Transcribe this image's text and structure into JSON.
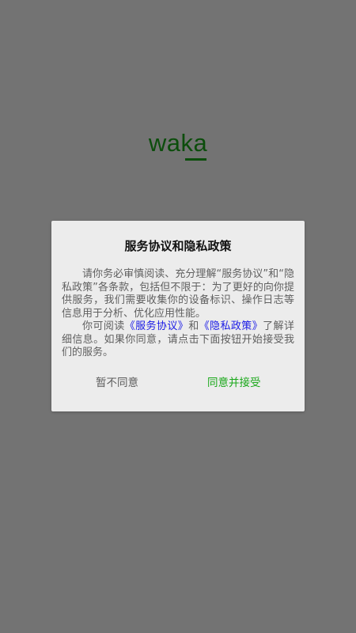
{
  "app": {
    "logo_text": "waka",
    "logo_color": "#0c4d0c",
    "background_color": "#737373"
  },
  "dialog": {
    "title": "服务协议和隐私政策",
    "paragraph1": "请你务必审慎阅读、充分理解“服务协议”和“隐私政策”各条款，包括但不限于：为了更好的向你提供服务，我们需要收集你的设备标识、操作日志等信息用于分析、优化应用性能。",
    "paragraph2_prefix": "你可阅读",
    "link_service": "《服务协议》",
    "paragraph2_and": "和",
    "link_privacy": "《隐私政策》",
    "paragraph2_suffix": "了解详细信息。如果你同意，请点击下面按钮开始接受我们的服务。",
    "link_color": "#1a1ae6",
    "disagree_label": "暂不同意",
    "agree_label": "同意并接受",
    "agree_color": "#1aa81a"
  }
}
